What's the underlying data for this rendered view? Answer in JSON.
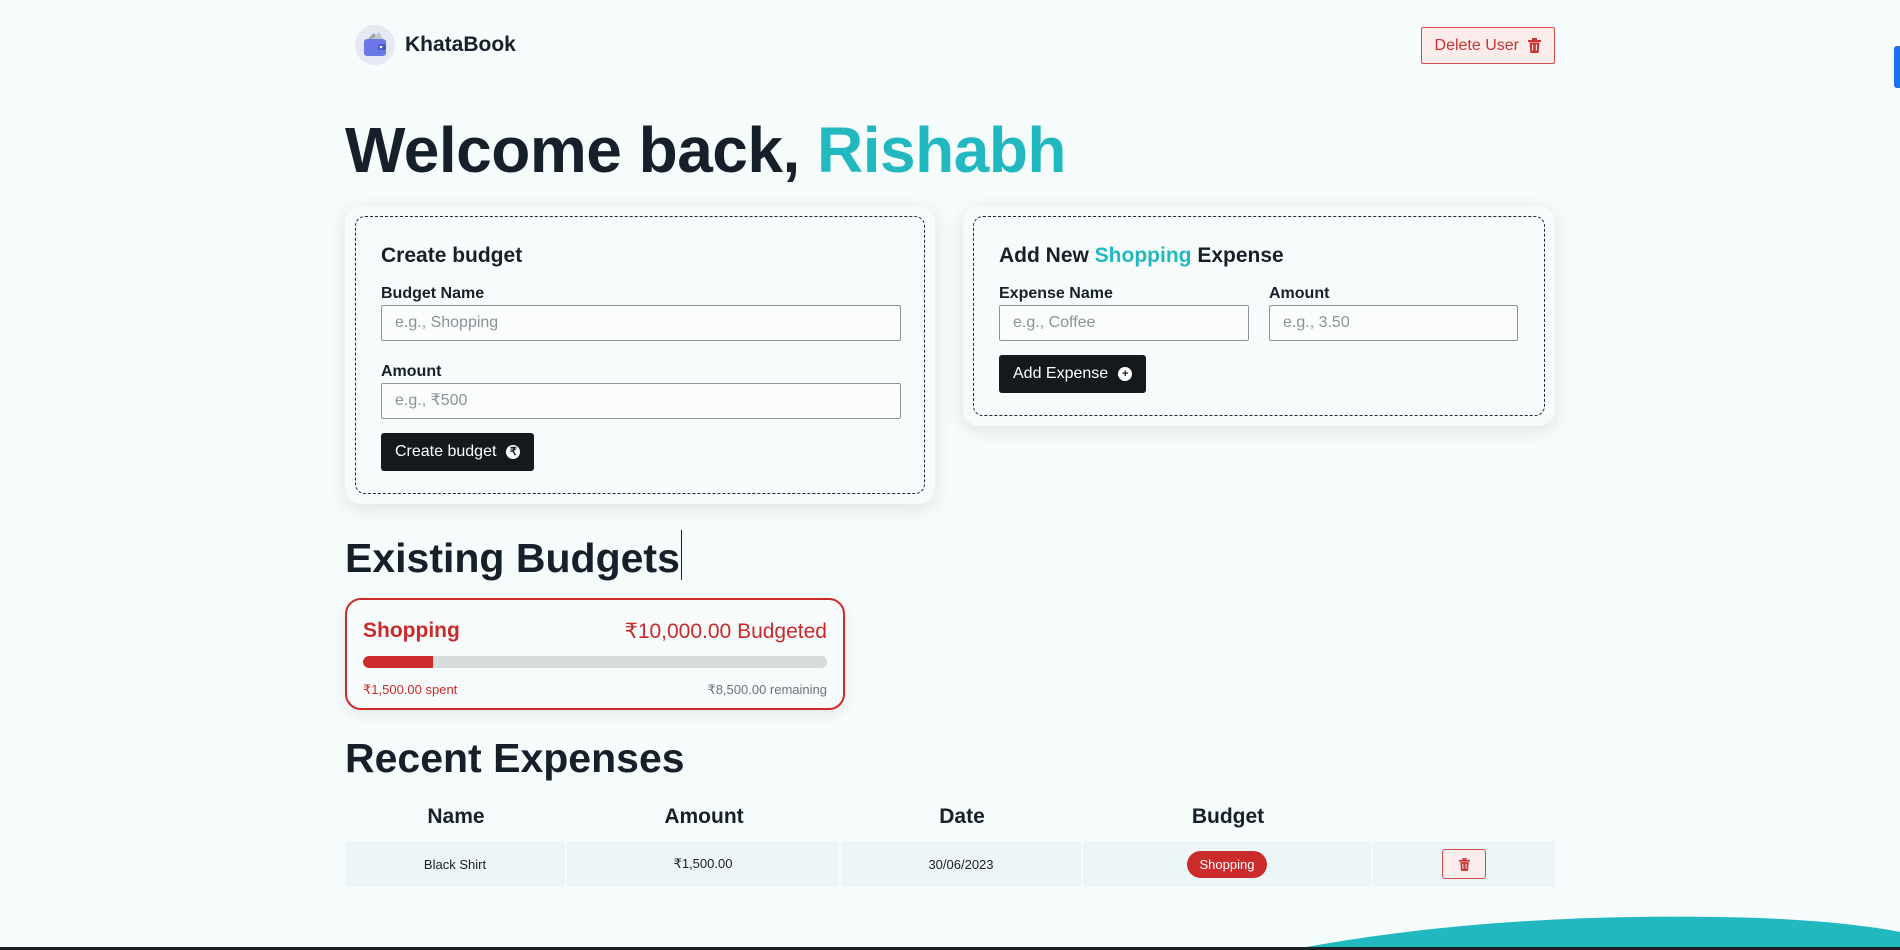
{
  "header": {
    "brand": "KhataBook",
    "delete_user_label": "Delete User"
  },
  "welcome": {
    "prefix": "Welcome back, ",
    "username": "Rishabh"
  },
  "create_budget": {
    "title": "Create budget",
    "name_label": "Budget Name",
    "name_placeholder": "e.g., Shopping",
    "amount_label": "Amount",
    "amount_placeholder": "e.g., ₹500",
    "button_label": "Create budget"
  },
  "add_expense": {
    "title_prefix": "Add New ",
    "title_budget": "Shopping",
    "title_suffix": " Expense",
    "name_label": "Expense Name",
    "name_placeholder": "e.g., Coffee",
    "amount_label": "Amount",
    "amount_placeholder": "e.g., 3.50",
    "button_label": "Add Expense"
  },
  "budgets": {
    "heading": "Existing Budgets",
    "items": [
      {
        "name": "Shopping",
        "budgeted": "₹10,000.00 Budgeted",
        "spent": "₹1,500.00 spent",
        "remaining": "₹8,500.00 remaining",
        "progress": 0.15,
        "color": "#cc2b2b"
      }
    ]
  },
  "expenses": {
    "heading": "Recent Expenses",
    "columns": [
      "Name",
      "Amount",
      "Date",
      "Budget"
    ],
    "rows": [
      {
        "name": "Black Shirt",
        "amount": "₹1,500.00",
        "date": "30/06/2023",
        "budget": "Shopping"
      }
    ]
  },
  "colors": {
    "accent": "#21b8c0",
    "danger": "#cc2b2b",
    "dark": "#13191d"
  }
}
